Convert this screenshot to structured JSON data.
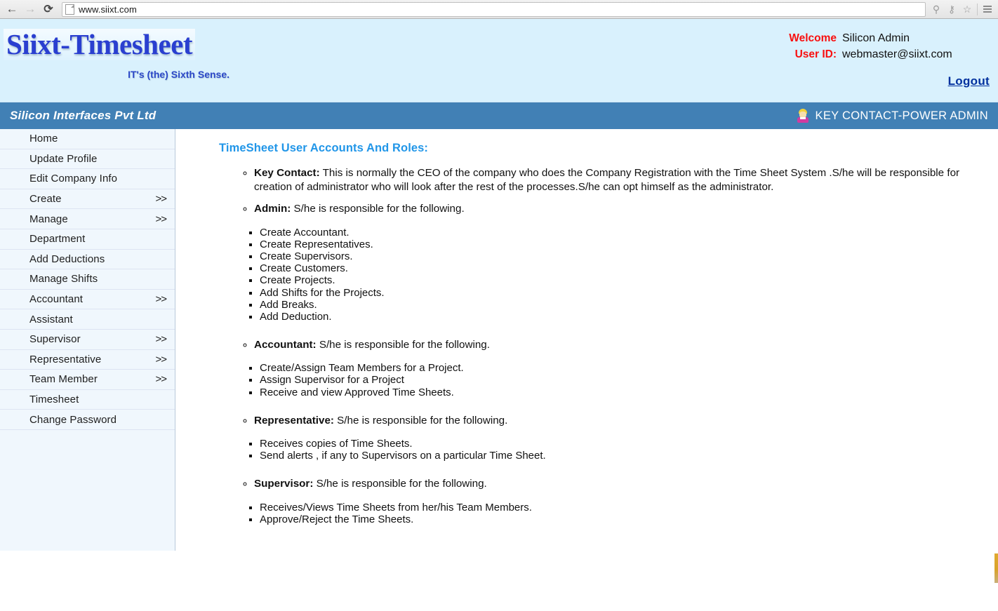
{
  "browser": {
    "back_icon": "back-arrow-icon",
    "forward_icon": "forward-arrow-icon",
    "reload_icon": "reload-icon",
    "url": "www.siixt.com",
    "zoom_icon": "magnifier-icon",
    "key_icon": "key-icon",
    "bookmark_icon": "star-icon",
    "menu_icon": "hamburger-menu-icon"
  },
  "header": {
    "logo_title": "Siixt-Timesheet",
    "logo_tagline": "IT's (the) Sixth Sense.",
    "welcome_label": "Welcome",
    "welcome_value": "Silicon Admin",
    "userid_label": "User ID:",
    "userid_value": "webmaster@siixt.com",
    "logout_label": "Logout",
    "accent_red": "#f80f0f",
    "accent_blue": "#00309e",
    "background": "#d9f1fd"
  },
  "company_bar": {
    "company_name": "Silicon Interfaces Pvt Ltd",
    "role_label": "KEY CONTACT-POWER ADMIN",
    "avatar_icon": "user-avatar-icon",
    "background": "#4180b5"
  },
  "sidebar": {
    "items": [
      {
        "label": "Home",
        "arrow": ""
      },
      {
        "label": "Update Profile",
        "arrow": ""
      },
      {
        "label": "Edit Company Info",
        "arrow": ""
      },
      {
        "label": "Create",
        "arrow": ">>"
      },
      {
        "label": "Manage",
        "arrow": ">>"
      },
      {
        "label": "Department",
        "arrow": ""
      },
      {
        "label": "Add Deductions",
        "arrow": ""
      },
      {
        "label": "Manage Shifts",
        "arrow": ""
      },
      {
        "label": "Accountant",
        "arrow": ">>"
      },
      {
        "label": "Assistant",
        "arrow": ""
      },
      {
        "label": "Supervisor",
        "arrow": ">>"
      },
      {
        "label": "Representative",
        "arrow": ">>"
      },
      {
        "label": "Team Member",
        "arrow": ">>"
      },
      {
        "label": "Timesheet",
        "arrow": ""
      },
      {
        "label": "Change Password",
        "arrow": ""
      }
    ]
  },
  "main": {
    "title": "TimeSheet User Accounts And Roles:",
    "title_color": "#2196e8",
    "roles": [
      {
        "name": "Key Contact:",
        "description": " This is normally the CEO of the company who does the Company Registration with the Time Sheet System .S/he will be responsible for creation of administrator who will look after the rest of the processes.S/he can opt himself as the administrator.",
        "duties": []
      },
      {
        "name": "Admin:",
        "description": " S/he is responsible for the following.",
        "duties": [
          "Create Accountant.",
          "Create Representatives.",
          "Create Supervisors.",
          "Create Customers.",
          "Create Projects.",
          "Add Shifts for the Projects.",
          "Add Breaks.",
          "Add Deduction."
        ]
      },
      {
        "name": "Accountant:",
        "description": " S/he is responsible for the following.",
        "duties": [
          "Create/Assign Team Members for a Project.",
          "Assign Supervisor for a Project",
          "Receive and view Approved Time Sheets."
        ]
      },
      {
        "name": "Representative:",
        "description": " S/he is responsible for the following.",
        "duties": [
          "Receives copies of Time Sheets.",
          "Send alerts , if any to Supervisors on a particular Time Sheet."
        ]
      },
      {
        "name": "Supervisor:",
        "description": " S/he is responsible for the following.",
        "duties": [
          "Receives/Views Time Sheets from her/his Team Members.",
          "Approve/Reject the Time Sheets."
        ]
      }
    ]
  }
}
